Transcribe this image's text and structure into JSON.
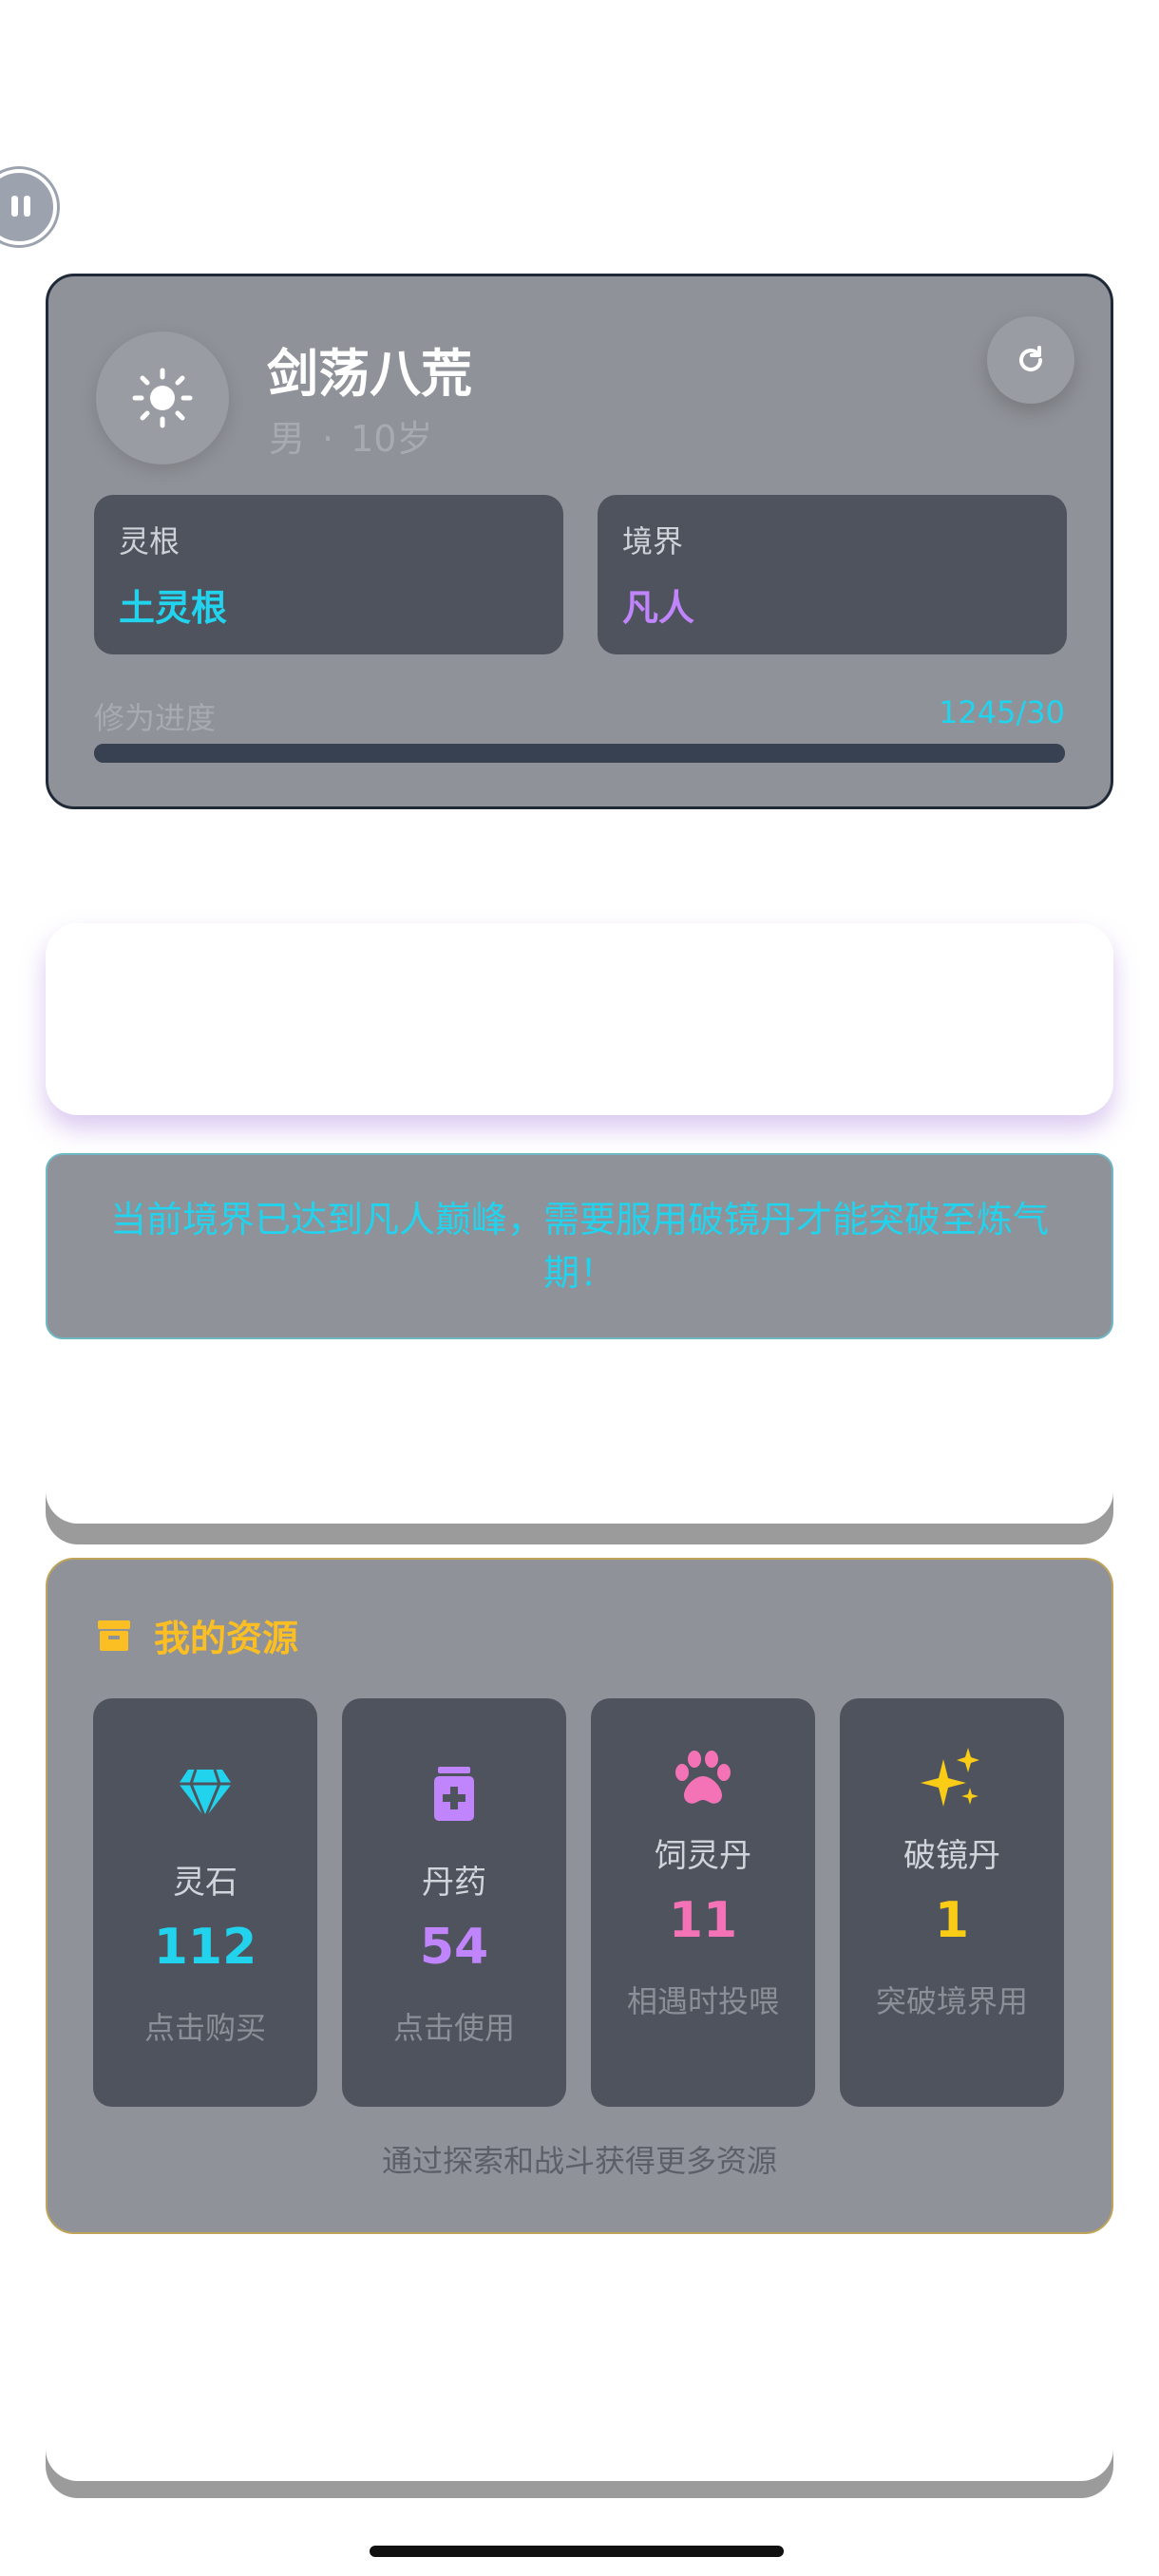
{
  "profile": {
    "name": "剑荡八荒",
    "gender": "男",
    "separator": "·",
    "age": "10岁",
    "spirit_root_label": "灵根",
    "spirit_root_value": "土灵根",
    "realm_label": "境界",
    "realm_value": "凡人",
    "progress_label": "修为进度",
    "progress_value": "1245/30",
    "progress_fraction": 1.0
  },
  "notice": {
    "text": "当前境界已达到凡人巅峰，需要服用破镜丹才能突破至炼气期！"
  },
  "resources": {
    "title": "我的资源",
    "items": [
      {
        "name": "灵石",
        "count": "112",
        "hint": "点击购买",
        "icon": "diamond-icon"
      },
      {
        "name": "丹药",
        "count": "54",
        "hint": "点击使用",
        "icon": "medicine-bottle-icon"
      },
      {
        "name": "饲灵丹",
        "count": "11",
        "hint": "相遇时投喂",
        "icon": "paw-icon"
      },
      {
        "name": "破镜丹",
        "count": "1",
        "hint": "突破境界用",
        "icon": "sparkles-icon"
      }
    ],
    "footer": "通过探索和战斗获得更多资源"
  },
  "colors": {
    "cyan": "#22d3ee",
    "purple": "#c084fc",
    "pink": "#f472b6",
    "yellow": "#facc15",
    "amber": "#fbbf24"
  }
}
